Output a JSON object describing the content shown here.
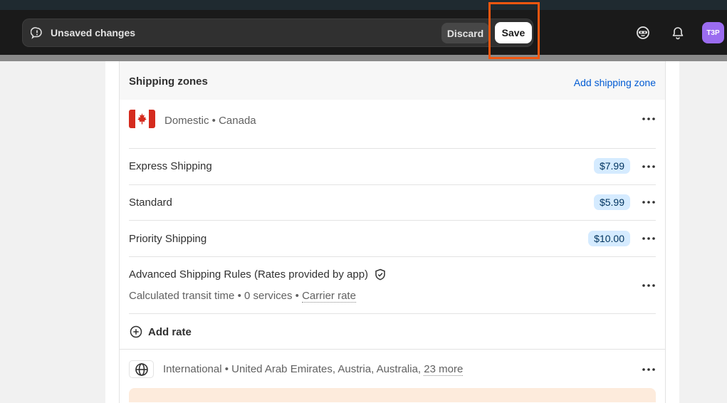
{
  "topbar": {
    "unsaved_label": "Unsaved changes",
    "discard_label": "Discard",
    "save_label": "Save",
    "avatar_initials": "T3P",
    "icons": [
      "alert-icon",
      "sidekick-icon",
      "bell-icon"
    ]
  },
  "card": {
    "title": "Shipping zones",
    "add_zone_label": "Add shipping zone",
    "domestic_zone": {
      "name": "Domestic • Canada",
      "flag": "canada-flag-icon"
    },
    "rates": [
      {
        "name": "Express Shipping",
        "price": "$7.99"
      },
      {
        "name": "Standard",
        "price": "$5.99"
      },
      {
        "name": "Priority Shipping",
        "price": "$10.00"
      }
    ],
    "advanced": {
      "name": "Advanced Shipping Rules (Rates provided by app)",
      "detail_prefix": "Calculated transit time • 0 services • ",
      "detail_link": "Carrier rate"
    },
    "add_rate_label": "Add rate",
    "international_zone": {
      "name_prefix": "International • United Arab Emirates, Austria, Australia, ",
      "more_link": "23 more"
    }
  },
  "colors": {
    "accent_link": "#005bd3",
    "price_badge": "#d5ebff",
    "highlight": "#f2560f",
    "avatar": "#9b6cf0"
  }
}
